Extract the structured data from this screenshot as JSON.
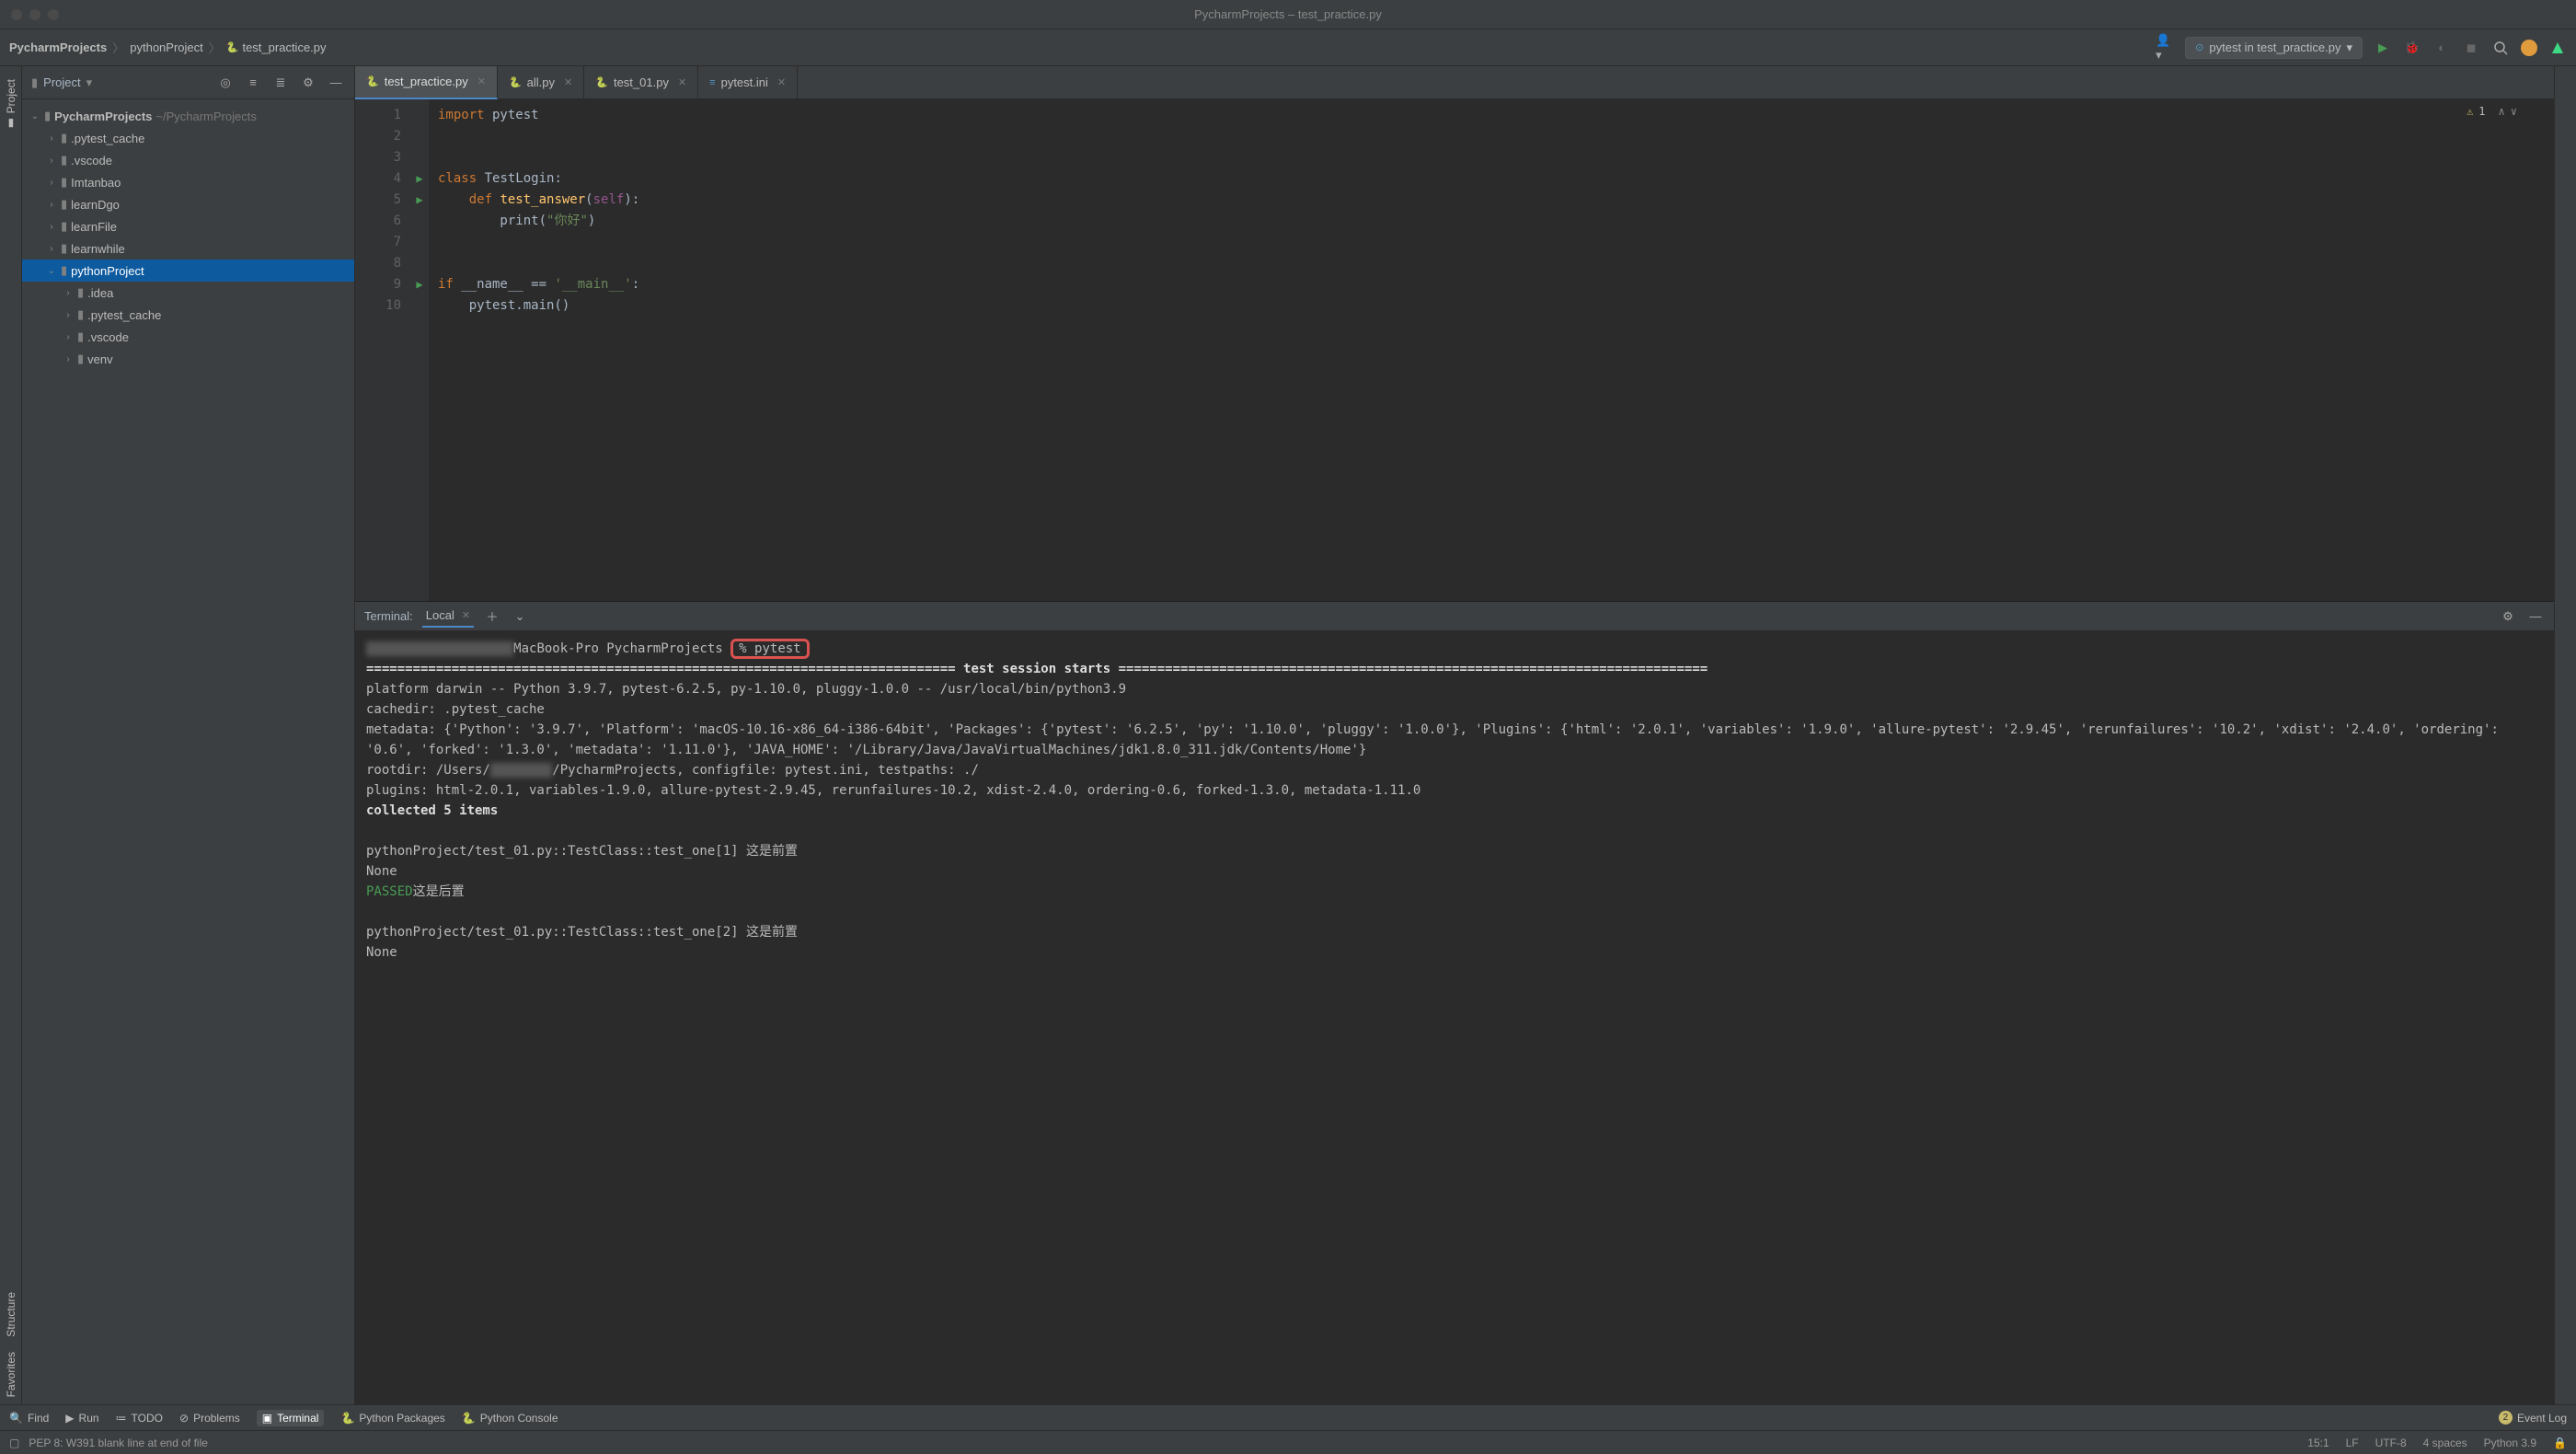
{
  "window": {
    "title": "PycharmProjects – test_practice.py"
  },
  "breadcrumb": {
    "root": "PycharmProjects",
    "project": "pythonProject",
    "file": "test_practice.py"
  },
  "run_config": {
    "label": "pytest in test_practice.py"
  },
  "project_panel": {
    "title": "Project",
    "root_name": "PycharmProjects",
    "root_path": "~/PycharmProjects",
    "tree": [
      {
        "name": ".pytest_cache",
        "depth": 1,
        "arrow": "›"
      },
      {
        "name": ".vscode",
        "depth": 1,
        "arrow": "›"
      },
      {
        "name": "Imtanbao",
        "depth": 1,
        "arrow": "›"
      },
      {
        "name": "learnDgo",
        "depth": 1,
        "arrow": "›"
      },
      {
        "name": "learnFile",
        "depth": 1,
        "arrow": "›"
      },
      {
        "name": "learnwhile",
        "depth": 1,
        "arrow": "›"
      },
      {
        "name": "pythonProject",
        "depth": 1,
        "arrow": "⌄",
        "selected": true
      },
      {
        "name": ".idea",
        "depth": 2,
        "arrow": "›"
      },
      {
        "name": ".pytest_cache",
        "depth": 2,
        "arrow": "›"
      },
      {
        "name": ".vscode",
        "depth": 2,
        "arrow": "›"
      },
      {
        "name": "venv",
        "depth": 2,
        "arrow": "›"
      }
    ]
  },
  "tabs": [
    {
      "label": "test_practice.py",
      "active": true
    },
    {
      "label": "all.py",
      "active": false
    },
    {
      "label": "test_01.py",
      "active": false
    },
    {
      "label": "pytest.ini",
      "active": false,
      "ini": true
    }
  ],
  "editor": {
    "problems_count": "1",
    "lines": {
      "l1_import": "import",
      "l1_mod": " pytest",
      "l4_class": "class",
      "l4_name": " TestLogin:",
      "l5_def": "    def",
      "l5_fn": " test_answer",
      "l5_paren": "(",
      "l5_self": "self",
      "l5_end": "):",
      "l6_print": "        print(",
      "l6_str": "\"你好\"",
      "l6_end": ")",
      "l9_if": "if",
      "l9_name": " __name__ ",
      "l9_eq": "==",
      "l9_main": " '__main__'",
      "l9_colon": ":",
      "l10": "    pytest.main()"
    },
    "line_nums": [
      "1",
      "2",
      "3",
      "4",
      "5",
      "6",
      "7",
      "8",
      "9",
      "10"
    ]
  },
  "terminal": {
    "title": "Terminal:",
    "tab_local": "Local",
    "prompt_host": "MacBook-Pro PycharmProjects",
    "prompt_cmd": "% pytest",
    "session_header": "============================================================================ test session starts ============================================================================",
    "platform_line": "platform darwin -- Python 3.9.7, pytest-6.2.5, py-1.10.0, pluggy-1.0.0 -- /usr/local/bin/python3.9",
    "cache_line": "cachedir: .pytest_cache",
    "meta1": "metadata: {'Python': '3.9.7', 'Platform': 'macOS-10.16-x86_64-i386-64bit', 'Packages': {'pytest': '6.2.5', 'py': '1.10.0', 'pluggy': '1.0.0'}, 'Plugins': {'html': '2.0.1', 'variables': '1.9.0', 'allure-pytest': '2.9.45', 'rerunfailures': '10.2', 'xdist': '2.4.0', 'ordering': '0.6', 'forked': '1.3.0', 'metadata': '1.11.0'}, 'JAVA_HOME': '/Library/Java/JavaVirtualMachines/jdk1.8.0_311.jdk/Contents/Home'}",
    "rootdir_pre": "rootdir: /Users/",
    "rootdir_post": "/PycharmProjects, configfile: pytest.ini, testpaths: ./",
    "plugins": "plugins: html-2.0.1, variables-1.9.0, allure-pytest-2.9.45, rerunfailures-10.2, xdist-2.4.0, ordering-0.6, forked-1.3.0, metadata-1.11.0",
    "collected": "collected 5 items",
    "test1_line": "pythonProject/test_01.py::TestClass::test_one[1] 这是前置",
    "none1": "None",
    "passed": "PASSED",
    "teardown1": "这是后置",
    "test2_line": "pythonProject/test_01.py::TestClass::test_one[2] 这是前置",
    "none2": "None"
  },
  "left_rail": {
    "project": "Project"
  },
  "side_rails": {
    "structure": "Structure",
    "favorites": "Favorites"
  },
  "bottom_tools": {
    "find": "Find",
    "run": "Run",
    "todo": "TODO",
    "problems": "Problems",
    "terminal": "Terminal",
    "packages": "Python Packages",
    "console": "Python Console",
    "event_log": "Event Log",
    "event_count": "2"
  },
  "status": {
    "hint": "PEP 8: W391 blank line at end of file",
    "pos": "15:1",
    "lf": "LF",
    "enc": "UTF-8",
    "indent": "4 spaces",
    "python": "Python 3.9"
  }
}
